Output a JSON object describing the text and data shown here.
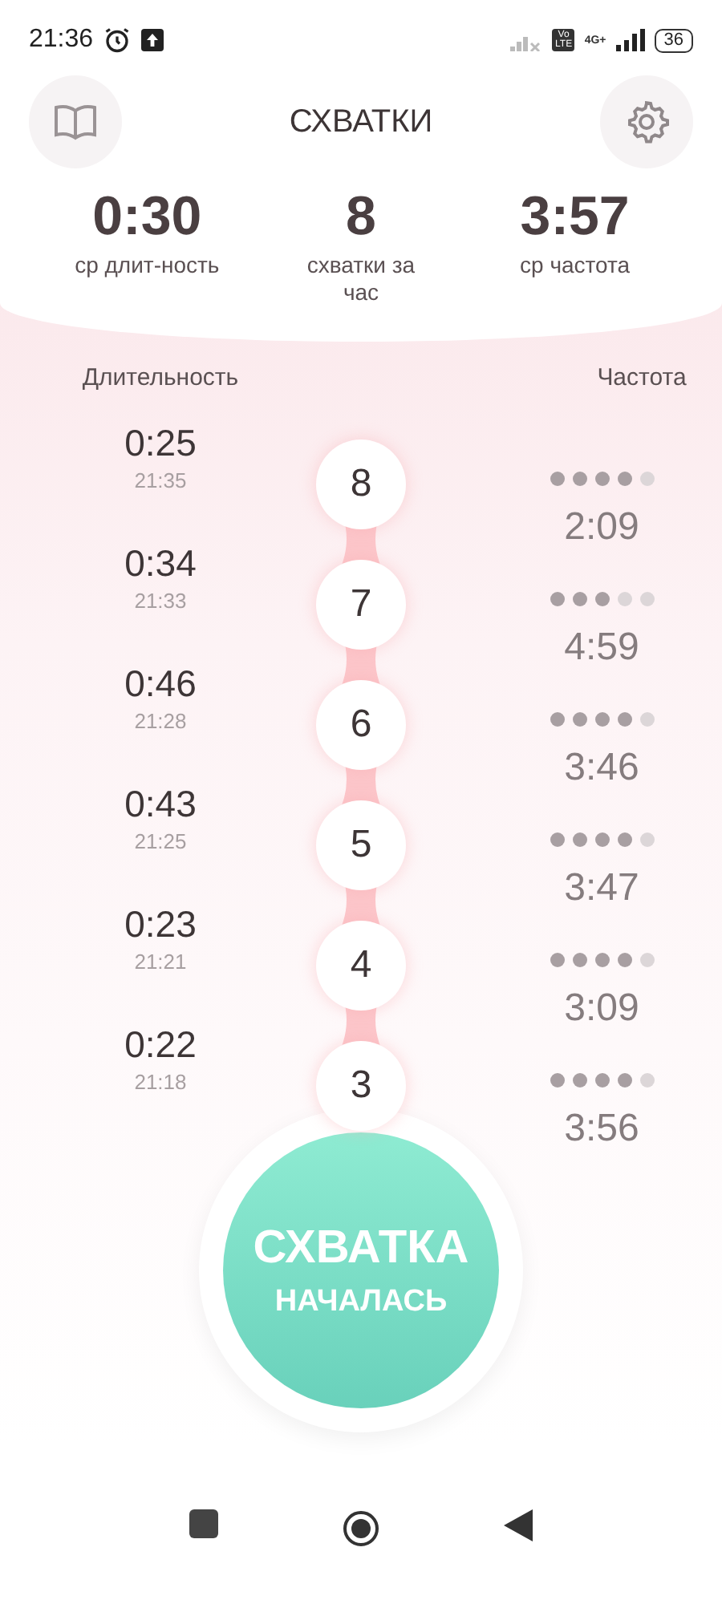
{
  "status_bar": {
    "time": "21:36",
    "volte": "Vo LTE",
    "network": "4G+",
    "battery": "36"
  },
  "header": {
    "title": "СХВАТКИ"
  },
  "stats": [
    {
      "value": "0:30",
      "label": "ср длит-ность"
    },
    {
      "value": "8",
      "label": "схватки за час"
    },
    {
      "value": "3:57",
      "label": "ср частота"
    }
  ],
  "columns": {
    "left": "Длительность",
    "right": "Частота"
  },
  "contractions": [
    {
      "duration": "0:25",
      "time": "21:35",
      "number": "8",
      "stars": 4,
      "frequency": "2:09"
    },
    {
      "duration": "0:34",
      "time": "21:33",
      "number": "7",
      "stars": 3,
      "frequency": "4:59"
    },
    {
      "duration": "0:46",
      "time": "21:28",
      "number": "6",
      "stars": 4,
      "frequency": "3:46"
    },
    {
      "duration": "0:43",
      "time": "21:25",
      "number": "5",
      "stars": 4,
      "frequency": "3:47"
    },
    {
      "duration": "0:23",
      "time": "21:21",
      "number": "4",
      "stars": 4,
      "frequency": "3:09"
    },
    {
      "duration": "0:22",
      "time": "21:18",
      "number": "3",
      "stars": 4,
      "frequency": "3:56"
    }
  ],
  "start_button": {
    "line1": "СХВАТКА",
    "line2": "НАЧАЛАСЬ"
  }
}
